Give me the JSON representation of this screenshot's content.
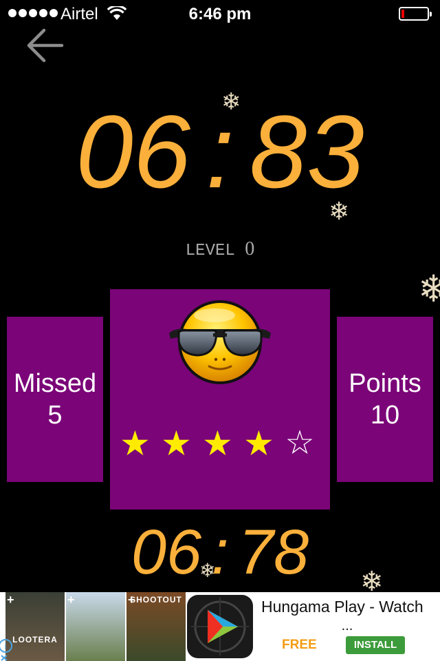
{
  "status_bar": {
    "carrier": "Airtel",
    "time": "6:46 pm",
    "battery_level": 0.1
  },
  "game": {
    "timer_main": {
      "left": "06",
      "separator": ":",
      "right": "83"
    },
    "level": {
      "label": "LEVEL",
      "value": "0"
    },
    "missed": {
      "label": "Missed",
      "value": "5"
    },
    "points": {
      "label": "Points",
      "value": "10"
    },
    "emoji": "sunglasses-smiley",
    "rating": {
      "filled": 4,
      "total": 5,
      "filled_glyph": "★",
      "empty_glyph": "☆"
    },
    "timer_secondary": {
      "left": "06",
      "separator": ":",
      "right": "78"
    }
  },
  "ad": {
    "posters": [
      {
        "title": "LOOTERA",
        "bg_top": "#3a3f35",
        "bg_bottom": "#6b5a44"
      },
      {
        "title": "",
        "bg_top": "#c9d9ea",
        "bg_bottom": "#6a7f4e"
      },
      {
        "title": "SHOOTOUT",
        "bg_top": "#7c4a26",
        "bg_bottom": "#3b4a2a"
      }
    ],
    "app_title": "Hungama Play - Watch",
    "app_title_more": "...",
    "price_label": "FREE",
    "install_label": "INSTALL"
  },
  "colors": {
    "timer": "#fbb03b",
    "panel": "#7a0478",
    "star": "#ffeb00",
    "install": "#3c9b3a",
    "free": "#f39c12"
  }
}
